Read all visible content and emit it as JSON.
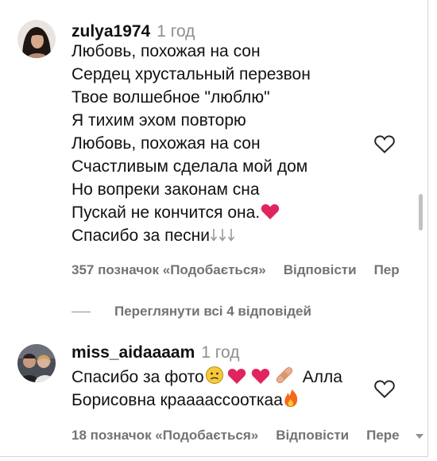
{
  "comments": [
    {
      "username": "zulya1974",
      "time": "1 год",
      "lines": [
        "Любовь, похожая на сон",
        "Сердец хрустальный перезвон",
        "Твое волшебное \"люблю\"",
        "Я тихим эхом повторю",
        "Любовь, похожая на сон",
        "Счастливым сделала мой дом",
        "Но вопреки законам сна",
        "Пускай не кончится она.",
        "Спасибо за песни"
      ],
      "likes": "357 позначок «Подобається»",
      "reply": "Відповісти",
      "more": "Пер"
    },
    {
      "username": "miss_aidaaaam",
      "time": "1 год",
      "lines": [
        "Спасибо за фото",
        "Алла",
        "Борисовна краааассооткаа"
      ],
      "likes": "18 позначок «Подобається»",
      "reply": "Відповісти",
      "more": "Пере"
    }
  ],
  "view_replies": "Переглянути всі 4 відповідей",
  "icons": {
    "heart_outline": "heart-outline-icon",
    "red_heart": "red-heart-emoji",
    "downward_arrows": "down-arrow-emoji",
    "sad_face": "sad-face-emoji",
    "bandage": "bandage-emoji",
    "fire": "fire-emoji"
  },
  "colors": {
    "text": "#111111",
    "secondary": "#737373",
    "heart_red": "#e0245e"
  }
}
